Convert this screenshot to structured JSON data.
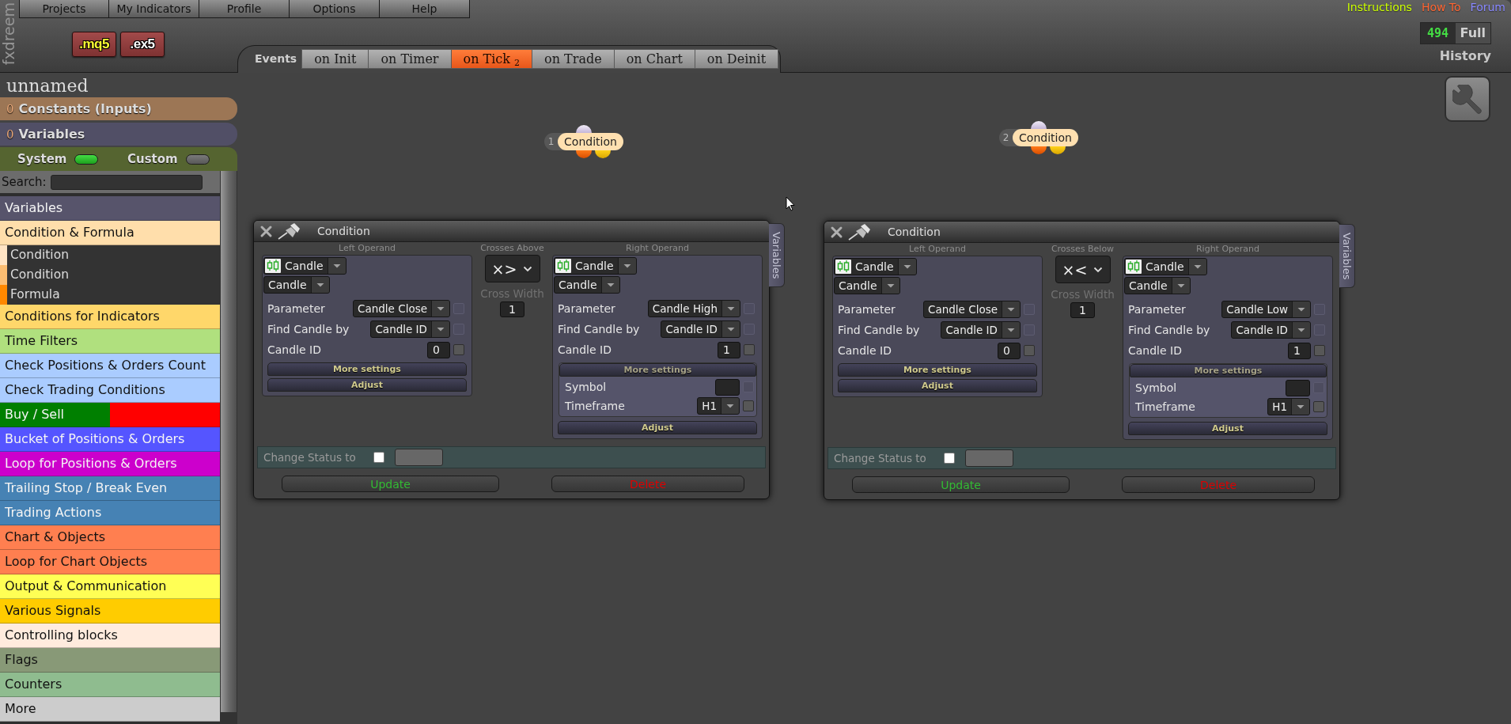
{
  "logo": {
    "text": "fxdreem"
  },
  "menu": [
    {
      "label": "Projects"
    },
    {
      "label": "My Indicators"
    },
    {
      "label": "Profile"
    },
    {
      "label": "Options"
    },
    {
      "label": "Help"
    }
  ],
  "export_buttons": [
    {
      "label": ".mq5",
      "kind": "source"
    },
    {
      "label": ".ex5",
      "kind": "compiled"
    }
  ],
  "events": {
    "label": "Events",
    "tabs": [
      {
        "label": "on Init",
        "selected": false
      },
      {
        "label": "on Timer",
        "selected": false
      },
      {
        "label": "on Tick $_{2}$",
        "selected": true
      },
      {
        "label": "on Trade",
        "selected": false
      },
      {
        "label": "on Chart",
        "selected": false
      },
      {
        "label": "on Deinit",
        "selected": false
      }
    ]
  },
  "links": [
    {
      "label": "Instructions",
      "color": "#ccff00"
    },
    {
      "label": "How To",
      "color": "#ff6633"
    },
    {
      "label": "Forum",
      "color": "#8888ff"
    }
  ],
  "version": {
    "number": "494",
    "edition": "Full"
  },
  "history": {
    "label": "History"
  },
  "project": {
    "name": "unnamed"
  },
  "sidebar": {
    "sections": [
      {
        "count": "0",
        "label": "Constants (Inputs)",
        "kind": "constants"
      },
      {
        "count": "0",
        "label": "Variables",
        "kind": "variables"
      }
    ],
    "toggles": [
      {
        "label": "System",
        "on": true
      },
      {
        "label": "Custom",
        "on": false
      }
    ],
    "search": {
      "label": "Search:"
    },
    "categories": [
      {
        "label": "Variables",
        "color": "#57546b"
      },
      {
        "label": "Condition & Formula",
        "color": "#ffdeab",
        "children": [
          {
            "label": "Condition",
            "color": "#ffe4c4"
          },
          {
            "label": "Condition",
            "color": "#fbbd72"
          },
          {
            "label": "Formula",
            "color": "#ff8800"
          }
        ]
      },
      {
        "label": "Conditions for Indicators",
        "color": "#ffd76a"
      },
      {
        "label": "Time Filters",
        "color": "#b0e07e"
      },
      {
        "label": "Check Positions & Orders Count",
        "color": "#aaccff"
      },
      {
        "label": "Check Trading Conditions",
        "color": "#aaccff"
      },
      {
        "label": "Buy / Sell",
        "color": "#007f00",
        "split": {
          "color": "#ff0000"
        }
      },
      {
        "label": "Bucket of Positions & Orders",
        "color": "#5555ff"
      },
      {
        "label": "Loop for Positions & Orders",
        "color": "#cc00cc"
      },
      {
        "label": "Trailing Stop / Break Even",
        "color": "#4682b4"
      },
      {
        "label": "Trading Actions",
        "color": "#4682b4"
      },
      {
        "label": "Chart & Objects",
        "color": "#ff7f50"
      },
      {
        "label": "Loop for Chart Objects",
        "color": "#ff7f50"
      },
      {
        "label": "Output & Communication",
        "color": "#ffff55"
      },
      {
        "label": "Various Signals",
        "color": "#ffcc00"
      },
      {
        "label": "Controlling blocks",
        "color": "#ffebdd"
      },
      {
        "label": "Flags",
        "color": "#889977"
      },
      {
        "label": "Counters",
        "color": "#8fbc8f"
      },
      {
        "label": "More",
        "color": "#cccccc"
      }
    ]
  },
  "blocks": [
    {
      "number": "1",
      "label": "Condition"
    },
    {
      "number": "2",
      "label": "Condition"
    }
  ],
  "panels": [
    {
      "title": "Condition",
      "side_tab": "Variables",
      "left": {
        "heading": "Left Operand",
        "source": "Candle",
        "type": "Candle",
        "fields": [
          {
            "label": "Parameter",
            "kind": "select",
            "value": "Candle Close",
            "checkbox": {
              "checked": false,
              "disabled": true
            }
          },
          {
            "label": "Find Candle by",
            "kind": "select",
            "value": "Candle ID",
            "checkbox": {
              "checked": false,
              "disabled": true
            }
          },
          {
            "label": "Candle ID",
            "kind": "input",
            "value": "0",
            "checkbox": {
              "checked": false,
              "disabled": false
            }
          }
        ],
        "more_settings": {
          "label": "More settings",
          "expanded": false
        },
        "adjust": "Adjust"
      },
      "operator": {
        "heading": "Crosses Above",
        "symbol": "×>",
        "width_label": "Cross Width",
        "width_value": "1"
      },
      "right": {
        "heading": "Right Operand",
        "source": "Candle",
        "type": "Candle",
        "fields": [
          {
            "label": "Parameter",
            "kind": "select",
            "value": "Candle High",
            "checkbox": {
              "checked": false,
              "disabled": true
            }
          },
          {
            "label": "Find Candle by",
            "kind": "select",
            "value": "Candle ID",
            "checkbox": {
              "checked": false,
              "disabled": true
            }
          },
          {
            "label": "Candle ID",
            "kind": "input",
            "value": "1",
            "checkbox": {
              "checked": false,
              "disabled": false
            }
          }
        ],
        "more_settings": {
          "label": "More settings",
          "expanded": true,
          "fields": [
            {
              "label": "Symbol",
              "kind": "input",
              "checkbox": {
                "checked": false,
                "disabled": true
              }
            },
            {
              "label": "Timeframe",
              "kind": "select",
              "value": "H1",
              "checkbox": {
                "checked": false,
                "disabled": false
              }
            }
          ]
        },
        "adjust": "Adjust"
      },
      "status": {
        "label": "Change Status to",
        "checked": false
      },
      "buttons": [
        {
          "label": "Update",
          "kind": "update"
        },
        {
          "label": "Delete",
          "kind": "delete"
        }
      ]
    },
    {
      "title": "Condition",
      "side_tab": "Variables",
      "left": {
        "heading": "Left Operand",
        "source": "Candle",
        "type": "Candle",
        "fields": [
          {
            "label": "Parameter",
            "kind": "select",
            "value": "Candle Close",
            "checkbox": {
              "checked": false,
              "disabled": true
            }
          },
          {
            "label": "Find Candle by",
            "kind": "select",
            "value": "Candle ID",
            "checkbox": {
              "checked": false,
              "disabled": true
            }
          },
          {
            "label": "Candle ID",
            "kind": "input",
            "value": "0",
            "checkbox": {
              "checked": false,
              "disabled": false
            }
          }
        ],
        "more_settings": {
          "label": "More settings",
          "expanded": false
        },
        "adjust": "Adjust"
      },
      "operator": {
        "heading": "Crosses Below",
        "symbol": "×<",
        "width_label": "Cross Width",
        "width_value": "1"
      },
      "right": {
        "heading": "Right Operand",
        "source": "Candle",
        "type": "Candle",
        "fields": [
          {
            "label": "Parameter",
            "kind": "select",
            "value": "Candle Low",
            "checkbox": {
              "checked": false,
              "disabled": true
            }
          },
          {
            "label": "Find Candle by",
            "kind": "select",
            "value": "Candle ID",
            "checkbox": {
              "checked": false,
              "disabled": true
            }
          },
          {
            "label": "Candle ID",
            "kind": "input",
            "value": "1",
            "checkbox": {
              "checked": false,
              "disabled": false
            }
          }
        ],
        "more_settings": {
          "label": "More settings",
          "expanded": true,
          "fields": [
            {
              "label": "Symbol",
              "kind": "input",
              "checkbox": {
                "checked": false,
                "disabled": true
              }
            },
            {
              "label": "Timeframe",
              "kind": "select",
              "value": "H1",
              "checkbox": {
                "checked": false,
                "disabled": false
              }
            }
          ]
        },
        "adjust": "Adjust"
      },
      "status": {
        "label": "Change Status to",
        "checked": false
      },
      "buttons": [
        {
          "label": "Update",
          "kind": "update"
        },
        {
          "label": "Delete",
          "kind": "delete"
        }
      ]
    }
  ]
}
